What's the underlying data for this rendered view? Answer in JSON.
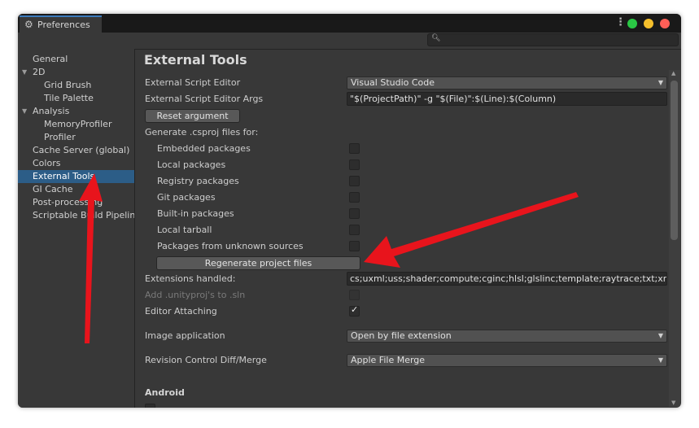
{
  "window": {
    "tab_title": "Preferences",
    "tab_icon": "gear-icon",
    "menu_icon": "kebab-menu-icon",
    "traffic_lights": [
      "#2ac845",
      "#f5bf2c",
      "#fe5f57"
    ]
  },
  "search": {
    "placeholder": "",
    "icon": "search-icon"
  },
  "sidebar": {
    "items": [
      {
        "label": "General"
      },
      {
        "label": "2D"
      },
      {
        "label": "Grid Brush"
      },
      {
        "label": "Tile Palette"
      },
      {
        "label": "Analysis"
      },
      {
        "label": "MemoryProfiler"
      },
      {
        "label": "Profiler"
      },
      {
        "label": "Cache Server (global)"
      },
      {
        "label": "Colors"
      },
      {
        "label": "External Tools",
        "selected": true
      },
      {
        "label": "GI Cache"
      },
      {
        "label": "Post-processing"
      },
      {
        "label": "Scriptable Build Pipeline"
      }
    ]
  },
  "main": {
    "title": "External Tools",
    "script_editor": {
      "label": "External Script Editor",
      "value": "Visual Studio Code"
    },
    "script_editor_args": {
      "label": "External Script Editor Args",
      "value": "\"$(ProjectPath)\" -g \"$(File)\":$(Line):$(Column)"
    },
    "reset_button": "Reset argument",
    "csproj_heading": "Generate .csproj files for:",
    "packages": [
      {
        "label": "Embedded packages",
        "checked": false
      },
      {
        "label": "Local packages",
        "checked": false
      },
      {
        "label": "Registry packages",
        "checked": false
      },
      {
        "label": "Git packages",
        "checked": false
      },
      {
        "label": "Built-in packages",
        "checked": false
      },
      {
        "label": "Local tarball",
        "checked": false
      },
      {
        "label": "Packages from unknown sources",
        "checked": false
      }
    ],
    "regenerate_button": "Regenerate project files",
    "extensions": {
      "label": "Extensions handled:",
      "value": "cs;uxml;uss;shader;compute;cginc;hlsl;glslinc;template;raytrace;txt;xml;"
    },
    "unityproj": {
      "label": "Add .unityproj's to .sln",
      "checked": false,
      "disabled": true
    },
    "editor_attaching": {
      "label": "Editor Attaching",
      "checked": true
    },
    "image_application": {
      "label": "Image application",
      "value": "Open by file extension"
    },
    "revision_control": {
      "label": "Revision Control Diff/Merge",
      "value": "Apple File Merge"
    },
    "android_heading": "Android"
  },
  "annotations": {
    "arrow_color": "#e8141c"
  }
}
